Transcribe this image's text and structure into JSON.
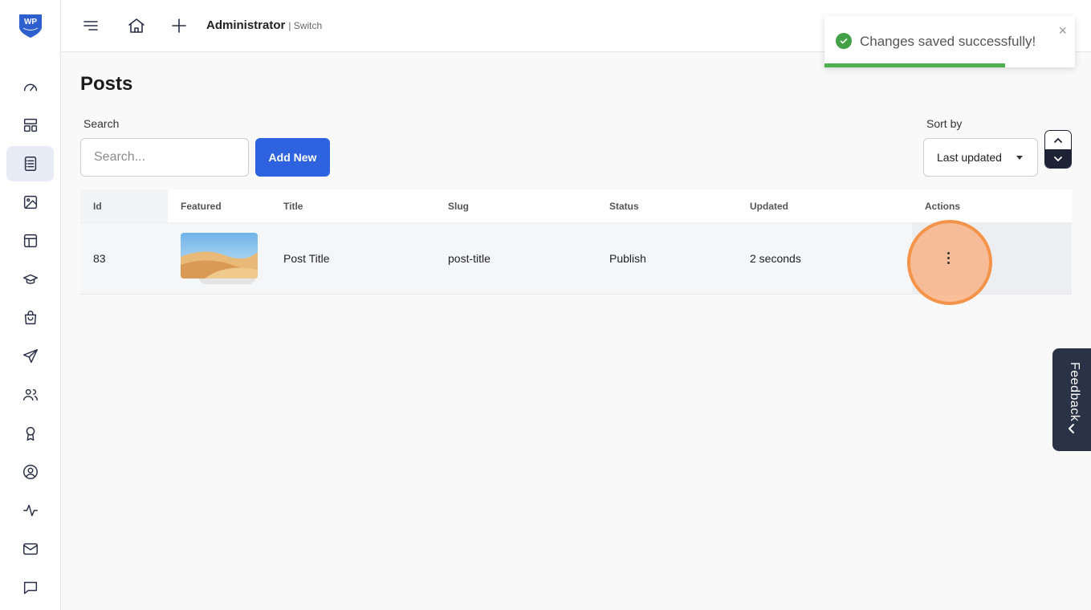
{
  "brand": {
    "logo_text": "WP"
  },
  "topbar": {
    "user_name": "Administrator",
    "switch_label": "| Switch"
  },
  "page": {
    "title": "Posts"
  },
  "search": {
    "label": "Search",
    "placeholder": "Search..."
  },
  "add_new": {
    "label": "Add New"
  },
  "sort": {
    "label": "Sort by",
    "selected": "Last updated"
  },
  "table": {
    "headers": {
      "id": "Id",
      "featured": "Featured",
      "title": "Title",
      "slug": "Slug",
      "status": "Status",
      "updated": "Updated",
      "actions": "Actions"
    },
    "rows": [
      {
        "id": "83",
        "title": "Post Title",
        "slug": "post-title",
        "status": "Publish",
        "updated": "2 seconds"
      }
    ]
  },
  "toast": {
    "message": "Changes saved successfully!",
    "close": "×",
    "progress_percent": 72
  },
  "feedback": {
    "label": "Feedback"
  },
  "colors": {
    "accent": "#2e62de",
    "success": "#43a047",
    "highlight": "#f4934a",
    "dark": "#2a3246"
  }
}
